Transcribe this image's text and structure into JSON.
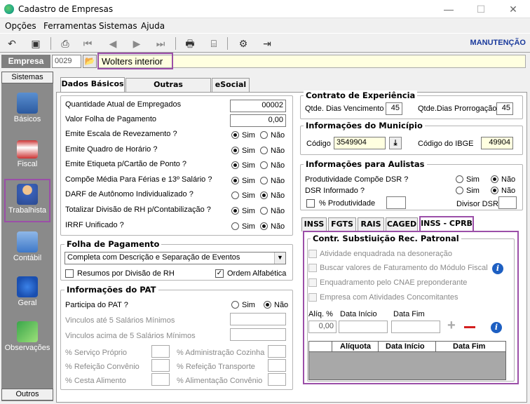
{
  "window": {
    "title": "Cadastro de Empresas"
  },
  "menu": [
    "Opções",
    "Ferramentas",
    "Sistemas",
    "Ajuda"
  ],
  "toolbar": {
    "mode_label": "MANUTENÇÃO"
  },
  "empresa": {
    "label": "Empresa",
    "code": "0029",
    "name": "Wolters interior"
  },
  "sidebar": {
    "top_label": "Sistemas",
    "bottom_label": "Outros",
    "items": [
      {
        "label": "Básicos",
        "icon": "buildings-icon"
      },
      {
        "label": "Fiscal",
        "icon": "invoice-icon"
      },
      {
        "label": "Trabalhista",
        "icon": "worker-icon"
      },
      {
        "label": "Contábil",
        "icon": "calculator-icon"
      },
      {
        "label": "Geral",
        "icon": "info-book-icon"
      },
      {
        "label": "Observações",
        "icon": "pencil-check-icon"
      }
    ]
  },
  "tabs": [
    "Dados Básicos",
    "Outras Informações",
    "eSocial"
  ],
  "left": {
    "rows": [
      {
        "label": "Quantidade Atual de Empregados",
        "value": "00002"
      },
      {
        "label": "Valor Folha de Pagamento",
        "value": "0,00"
      }
    ],
    "radio_rows": [
      {
        "label": "Emite Escala de Revezamento ?",
        "sim": "Sim",
        "nao": "Não",
        "selected": "sim"
      },
      {
        "label": "Emite Quadro de Horário ?",
        "sim": "Sim",
        "nao": "Não",
        "selected": "sim"
      },
      {
        "label": "Emite Etiqueta p/Cartão de Ponto ?",
        "sim": "Sim",
        "nao": "Não",
        "selected": "sim"
      },
      {
        "label": "Compõe Média Para Férias e 13º Salário ?",
        "sim": "Sim",
        "nao": "Não",
        "selected": "sim"
      },
      {
        "label": "DARF de Autônomo Individualizado ?",
        "sim": "Sim",
        "nao": "Não",
        "selected": "nao"
      },
      {
        "label": "Totalizar Divisão de RH p/Contabilização ?",
        "sim": "Sim",
        "nao": "Não",
        "selected": "sim"
      },
      {
        "label": "IRRF Unificado ?",
        "sim": "Sim",
        "nao": "Não",
        "selected": "nao"
      }
    ],
    "folha": {
      "title": "Folha de Pagamento",
      "select_value": "Completa com Descrição e Separação de Eventos",
      "resumos_label": "Resumos por Divisão de RH",
      "ordem_label": "Ordem Alfabética"
    },
    "pat": {
      "title": "Informações do PAT",
      "participa_label": "Participa do PAT ?",
      "sim": "Sim",
      "nao": "Não",
      "vinc_ate": "Vinculos até 5 Salários Mínimos",
      "vinc_acima": "Vinculos acima de 5 Salários Mínimos",
      "servico": "% Serviço Próprio",
      "adm": "% Administração Cozinha",
      "refeicao": "% Refeição Convênio",
      "transporte": "% Refeição Transporte",
      "cesta": "% Cesta Alimento",
      "alimentacao": "% Alimentação Convênio"
    }
  },
  "right": {
    "contrato": {
      "title": "Contrato de Experiência",
      "venc_label": "Qtde. Dias Vencimento",
      "venc_value": "45",
      "prorrog_label": "Qtde.Dias Prorrogação",
      "prorrog_value": "45"
    },
    "municipio": {
      "title": "Informações do Município",
      "codigo_label": "Código",
      "codigo_value": "3549904",
      "ibge_label": "Código do IBGE",
      "ibge_value": "49904"
    },
    "aulistas": {
      "title": "Informações para Aulistas",
      "prod_label": "Produtividade Compõe DSR ?",
      "dsr_label": "DSR Informado ?",
      "sim": "Sim",
      "nao": "Não",
      "pct_label": "% Produtividade",
      "divisor_label": "Divisor DSR"
    },
    "subtabs": [
      "INSS",
      "FGTS",
      "RAIS",
      "CAGED",
      "INSS - CPRB"
    ],
    "cprb": {
      "title": "Contr. Substiuição Rec. Patronal",
      "checks": [
        "Atividade enquadrada na desoneração",
        "Buscar valores de Faturamento do Módulo Fiscal",
        "Enquadramento pelo CNAE preponderante",
        "Empresa com Atividades Concomitantes"
      ],
      "aliq_label": "Alíq. %",
      "aliq_value": "0,00",
      "inicio_label": "Data Início",
      "fim_label": "Data Fim",
      "grid_headers": [
        "Alíquota",
        "Data Início",
        "Data Fim"
      ]
    }
  },
  "colors": {
    "accent": "#9b4fa8",
    "mode": "#1a3a9c",
    "highlight_field": "#ffffe0"
  }
}
